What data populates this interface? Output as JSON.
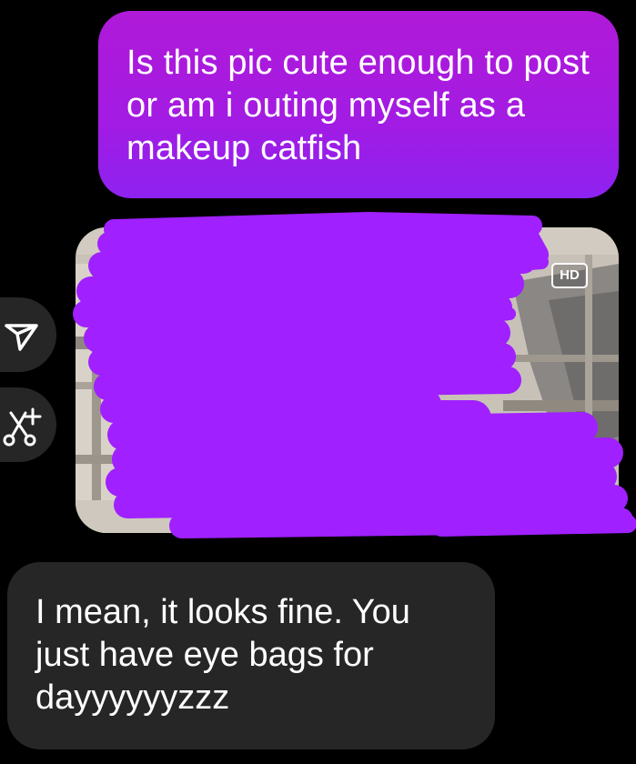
{
  "conversation": {
    "messages": [
      {
        "direction": "sent",
        "text": "Is this pic cute enough to post or am i outing myself as a makeup catfish"
      },
      {
        "direction": "received",
        "text": "I mean, it looks fine. You just have eye bags for dayyyyyyzzz"
      }
    ],
    "photo": {
      "badge": "HD"
    }
  },
  "side_actions": [
    {
      "icon": "share-icon"
    },
    {
      "icon": "ai-edit-icon"
    }
  ],
  "colors": {
    "background": "#000000",
    "sent_bubble": "#a81ae0",
    "received_bubble": "#262626",
    "scribble": "#a020ff",
    "text": "#ffffff"
  }
}
